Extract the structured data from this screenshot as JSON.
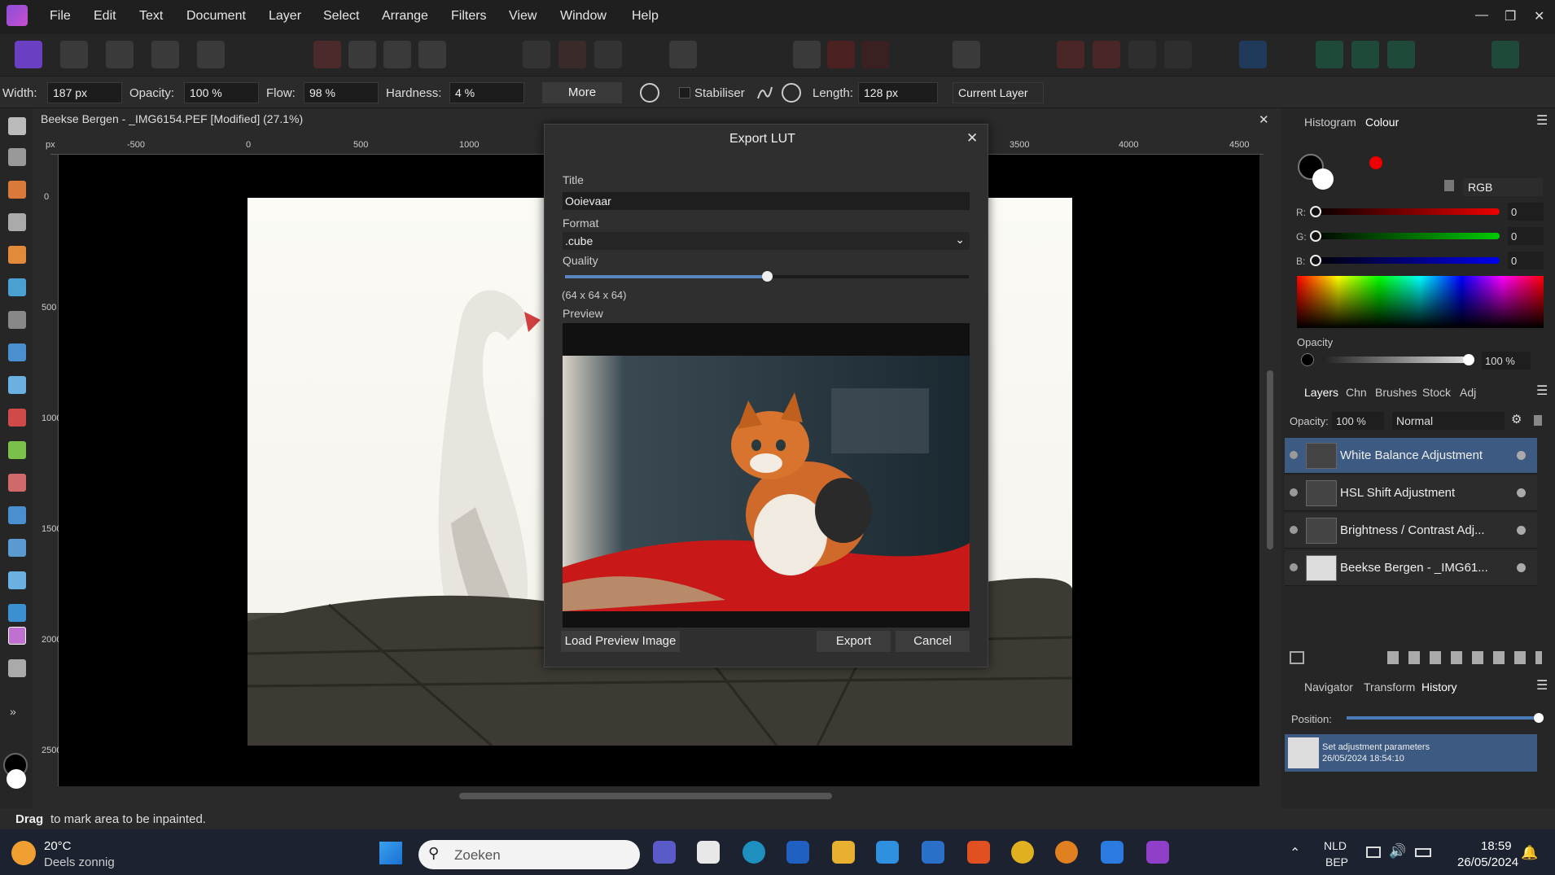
{
  "menu": [
    "File",
    "Edit",
    "Text",
    "Document",
    "Layer",
    "Select",
    "Arrange",
    "Filters",
    "View",
    "Window",
    "Help"
  ],
  "context": {
    "width_label": "Width:",
    "width_value": "187 px",
    "opacity_label": "Opacity:",
    "opacity_value": "100 %",
    "flow_label": "Flow:",
    "flow_value": "98 %",
    "hardness_label": "Hardness:",
    "hardness_value": "4 %",
    "more_label": "More",
    "stabiliser_label": "Stabiliser",
    "length_label": "Length:",
    "length_value": "128 px",
    "source_value": "Current Layer"
  },
  "document": {
    "tab_title": "Beekse Bergen - _IMG6154.PEF [Modified] (27.1%)",
    "ruler_unit": "px",
    "ruler_top": [
      "-500",
      "0",
      "500",
      "1000",
      "3500",
      "4000",
      "4500"
    ],
    "ruler_left": [
      "0",
      "500",
      "1000",
      "1500",
      "2000",
      "2500"
    ]
  },
  "dialog": {
    "title": "Export LUT",
    "title_label": "Title",
    "title_value": "Ooievaar",
    "format_label": "Format",
    "format_value": ".cube",
    "quality_label": "Quality",
    "quality_fraction": 0.5,
    "quality_detail": "(64 x 64 x 64)",
    "preview_label": "Preview",
    "load_label": "Load Preview Image",
    "export_label": "Export",
    "cancel_label": "Cancel"
  },
  "colour": {
    "tabs": [
      "Histogram",
      "Colour"
    ],
    "model": "RGB",
    "r_label": "R:",
    "g_label": "G:",
    "b_label": "B:",
    "r": "0",
    "g": "0",
    "b": "0",
    "opacity_label": "Opacity",
    "opacity_value": "100 %"
  },
  "layers_panel": {
    "tabs": [
      "Layers",
      "Chn",
      "Brushes",
      "Stock",
      "Adj"
    ],
    "opacity_label": "Opacity:",
    "opacity_value": "100 %",
    "blend": "Normal",
    "items": [
      "White Balance Adjustment",
      "HSL Shift Adjustment",
      "Brightness / Contrast Adj...",
      "Beekse Bergen - _IMG61..."
    ]
  },
  "history_panel": {
    "tabs": [
      "Navigator",
      "Transform",
      "History"
    ],
    "position_label": "Position:",
    "entry_title": "Set adjustment parameters",
    "entry_time": "26/05/2024 18:54:10"
  },
  "status": {
    "bold": "Drag",
    "text": "to mark area to be inpainted."
  },
  "taskbar": {
    "temp": "20°C",
    "weather": "Deels zonnig",
    "search": "Zoeken",
    "lang1": "NLD",
    "lang2": "BEP",
    "time": "18:59",
    "date": "26/05/2024"
  }
}
